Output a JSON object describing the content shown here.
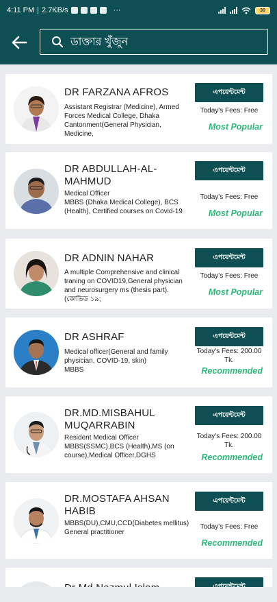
{
  "status_bar": {
    "time": "4:11 PM",
    "speed": "2.7KB/s",
    "more": "···",
    "battery": "30"
  },
  "header": {
    "search_placeholder": "ডাক্তার খুঁজুন"
  },
  "doctors": [
    {
      "name": "DR FARZANA AFROS",
      "description": "Assistant Registrar (Medicine), Armed Forces Medical College, Dhaka Cantonment(General Physician, Medicine,",
      "button": "এপয়েন্টমেন্ট",
      "fees": "Today's Fees: Free",
      "tag": "Most Popular"
    },
    {
      "name": "DR ABDULLAH-AL-MAHMUD",
      "description": "Medical Officer\nMBBS (Dhaka Medical College), BCS (Health), Certified courses on Covid-19",
      "button": "এপয়েন্টমেন্ট",
      "fees": "Today's Fees: Free",
      "tag": "Most Popular"
    },
    {
      "name": "DR ADNIN NAHAR",
      "description": "A multiple Comprehensive and clinical traning on COVID19,General physician and neurosurgery ms (thesis part).(কোভিড ১৯;",
      "button": "এপয়েন্টমেন্ট",
      "fees": "Today's Fees: Free",
      "tag": "Most Popular"
    },
    {
      "name": "DR ASHRAF",
      "description": "Medical officer(General and family physician, COVID-19, skin)\nMBBS",
      "button": "এপয়েন্টমেন্ট",
      "fees": "Today's Fees: 200.00 Tk.",
      "tag": "Recommended"
    },
    {
      "name": "DR.MD.MISBAHUL MUQARRABIN",
      "description": "Resident Medical Officer\nMBBS(SSMC),BCS (Health),MS (on course),Medical Officer,DGHS",
      "button": "এপয়েন্টমেন্ট",
      "fees": "Today's Fees: 200.00 Tk.",
      "tag": "Recommended"
    },
    {
      "name": "DR.MOSTAFA AHSAN HABIB",
      "description": "MBBS(DU),CMU,CCD(Diabetes mellitus)\nGeneral practitioner",
      "button": "এপয়েন্টমেন্ট",
      "fees": "Today's Fees: Free",
      "tag": "Recommended"
    },
    {
      "name": "Dr Md Nazmul Islam",
      "description": "",
      "button": "এপয়েন্টমেন্ট",
      "fees": "",
      "tag": ""
    }
  ],
  "colors": {
    "primary": "#0d4f52",
    "accent": "#2eb87b",
    "background": "#e9ebef"
  }
}
